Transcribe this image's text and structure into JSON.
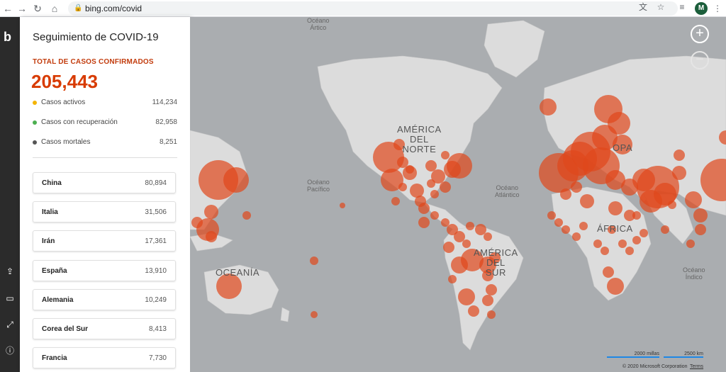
{
  "browser": {
    "url": "bing.com/covid",
    "avatar_letter": "M"
  },
  "rail": {
    "logo": "b"
  },
  "panel": {
    "title": "Seguimiento de COVID-19",
    "total_label": "TOTAL DE CASOS CONFIRMADOS",
    "total_value": "205,443",
    "stats": [
      {
        "label": "Casos activos",
        "value": "114,234",
        "color": "#f4b400"
      },
      {
        "label": "Casos con recuperación",
        "value": "82,958",
        "color": "#4caf50"
      },
      {
        "label": "Casos mortales",
        "value": "8,251",
        "color": "#555555"
      }
    ],
    "countries": [
      {
        "name": "China",
        "value": "80,894"
      },
      {
        "name": "Italia",
        "value": "31,506"
      },
      {
        "name": "Irán",
        "value": "17,361"
      },
      {
        "name": "España",
        "value": "13,910"
      },
      {
        "name": "Alemania",
        "value": "10,249"
      },
      {
        "name": "Corea del Sur",
        "value": "8,413"
      },
      {
        "name": "Francia",
        "value": "7,730"
      }
    ]
  },
  "map": {
    "ocean_labels": {
      "artico": "Océano\nÁrtico",
      "pacifico": "Océano\nPacífico",
      "atlantico": "Océano\nAtlántico",
      "indico": "Océano\nÍndico"
    },
    "region_labels": {
      "north_america": "AMÉRICA\nDEL\nNORTE",
      "south_america": "AMÉRICA\nDEL\nSUR",
      "africa": "ÁFRICA",
      "oceania": "OCEANÍA",
      "europe": "OPA"
    },
    "scale_miles": "2000 millas",
    "scale_km": "2500 km",
    "copyright": "© 2020 Microsoft Corporation",
    "terms": "Terms",
    "bubble_color": "#e0471b",
    "land_color": "#dcdcdc",
    "water_color": "#aaadb0"
  }
}
